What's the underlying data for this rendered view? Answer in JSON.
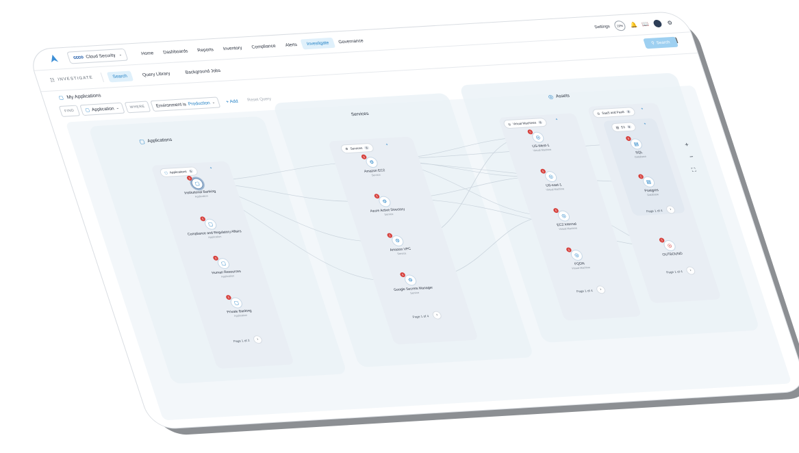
{
  "topbar": {
    "tenant": {
      "logo_text": "ccco",
      "label": "Cloud Security"
    },
    "nav": [
      "Home",
      "Dashboards",
      "Reports",
      "Inventory",
      "Compliance",
      "Alerts",
      "Investigate",
      "Governance"
    ],
    "active_nav": "Investigate",
    "settings_label": "Settings",
    "score_badge": "19%"
  },
  "subbar": {
    "title": "INVESTIGATE",
    "tabs": [
      "Search",
      "Query Library",
      "Background Jobs"
    ],
    "search_button": "Search"
  },
  "query": {
    "name": "My Applications",
    "find": "FIND",
    "entity": "Application",
    "where": "WHERE",
    "filter_key": "Environment is",
    "filter_value": "Production",
    "add": "Add",
    "reset": "Reset Query"
  },
  "graph": {
    "applications": {
      "title": "Applications",
      "chip": "Applications",
      "chip_count": "5",
      "nodes": [
        {
          "label": "Institutional Banking",
          "type": "Application",
          "badge": "3"
        },
        {
          "label": "Compliance and Regulatory Affairs",
          "type": "Application",
          "badge": "5"
        },
        {
          "label": "Human Resources",
          "type": "Application",
          "badge": "3"
        },
        {
          "label": "Private Banking",
          "type": "Application",
          "badge": "5"
        }
      ],
      "pager": "Page 1 of 2"
    },
    "services": {
      "title": "Services",
      "chip": "Services",
      "chip_count": "8",
      "nodes": [
        {
          "label": "Amazon EC2",
          "type": "Service",
          "badge": "5"
        },
        {
          "label": "Azure Active Directory",
          "type": "Service",
          "badge": "5"
        },
        {
          "label": "Amazon VPC",
          "type": "Service",
          "badge": "5"
        },
        {
          "label": "Google Secrets Manager",
          "type": "Service",
          "badge": "5"
        }
      ],
      "pager": "Page 1 of 4"
    },
    "assets": {
      "title": "Assets",
      "vm_chip": "Virtual Machines",
      "vm_count": "8",
      "vm_nodes": [
        {
          "label": "US-West-1",
          "type": "Virtual Machine",
          "badge": "5"
        },
        {
          "label": "US-east-1",
          "type": "Virtual Machine",
          "badge": "5"
        },
        {
          "label": "EC2 Internal",
          "type": "Virtual Machine",
          "badge": "5"
        },
        {
          "label": "FQDN",
          "type": "Virtual Machine",
          "badge": "5"
        }
      ],
      "vm_pager": "Page 1 of 4",
      "saas_chip": "SaaS and PaaS",
      "saas_count": "8",
      "s3_chip": "S3",
      "s3_count": "8",
      "saas_nodes": [
        {
          "label": "SQL",
          "type": "Database",
          "badge": "5"
        },
        {
          "label": "Postgres",
          "type": "Database",
          "badge": "5"
        }
      ],
      "saas_pager": "Page 1 of 4",
      "outbound_label": "OUTBOUND",
      "outbound_badge": "5",
      "outbound_pager": "Page 1 of 4"
    }
  },
  "colors": {
    "accent": "#1f7fc4",
    "badge": "#d6403c",
    "search_button": "#9ed0f1"
  }
}
